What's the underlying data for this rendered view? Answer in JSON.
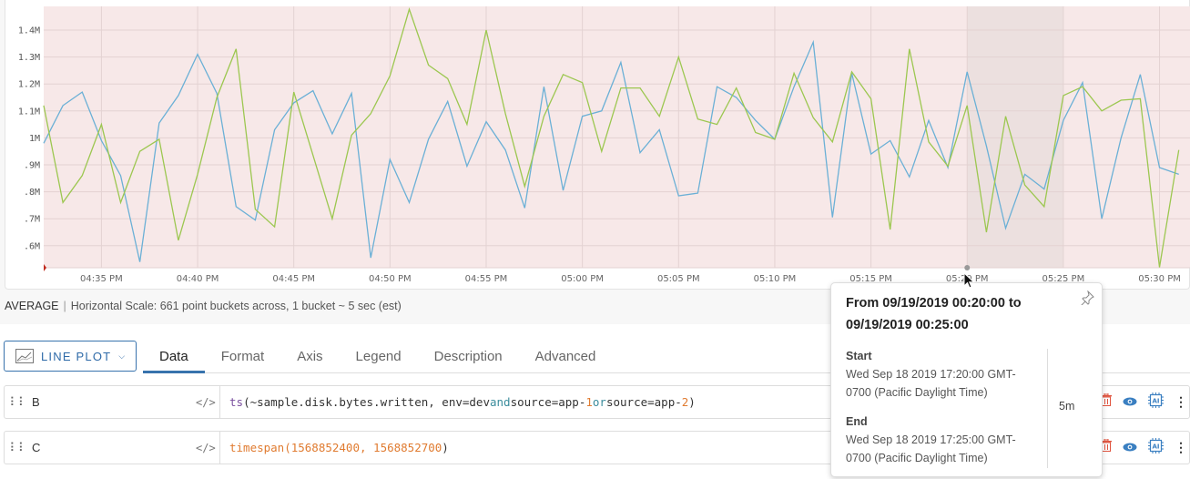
{
  "chart_data": {
    "type": "line",
    "title": "",
    "xlabel": "",
    "ylabel": "",
    "ylim": [
      0.52,
      1.48
    ],
    "y_unit": "M",
    "yticks": [
      0.6,
      0.7,
      0.8,
      0.9,
      1.0,
      1.1,
      1.2,
      1.3,
      1.4
    ],
    "ytick_labels": [
      ".6M",
      ".7M",
      ".8M",
      ".9M",
      "1M",
      "1.1M",
      "1.2M",
      "1.3M",
      "1.4M"
    ],
    "x_start": "04:32 PM",
    "x_step_minutes": 1,
    "xtick_labels": [
      "04:35 PM",
      "04:40 PM",
      "04:45 PM",
      "04:50 PM",
      "04:55 PM",
      "05:00 PM",
      "05:05 PM",
      "05:10 PM",
      "05:15 PM",
      "05:20 PM",
      "05:25 PM",
      "05:30 PM"
    ],
    "xtick_minute_offsets": [
      3,
      8,
      13,
      18,
      23,
      28,
      33,
      38,
      43,
      48,
      53,
      58
    ],
    "grid": true,
    "background_color": "#f7e8e8",
    "highlight_range": {
      "from": "05:20 PM",
      "to": "05:25 PM",
      "color": "#ece0df"
    },
    "series": [
      {
        "name": "app-1",
        "color": "#6bb0d6",
        "values": [
          0.98,
          1.12,
          1.17,
          0.99,
          0.86,
          0.54,
          1.055,
          1.157,
          1.31,
          1.165,
          0.745,
          0.695,
          1.03,
          1.13,
          1.175,
          1.015,
          1.165,
          0.555,
          0.92,
          0.76,
          0.995,
          1.135,
          0.895,
          1.06,
          0.955,
          0.74,
          1.19,
          0.805,
          1.08,
          1.1,
          1.28,
          0.945,
          1.03,
          0.785,
          0.795,
          1.19,
          1.15,
          1.065,
          0.995,
          1.19,
          1.355,
          0.705,
          1.24,
          0.94,
          0.99,
          0.855,
          1.065,
          0.89,
          1.245,
          0.97,
          0.665,
          0.865,
          0.81,
          1.065,
          1.205,
          0.7,
          1.0,
          1.235,
          0.89,
          0.865
        ]
      },
      {
        "name": "app-2",
        "color": "#9cc750",
        "values": [
          1.12,
          0.76,
          0.86,
          1.05,
          0.76,
          0.95,
          0.995,
          0.62,
          0.865,
          1.15,
          1.33,
          0.735,
          0.67,
          1.17,
          0.935,
          0.7,
          1.01,
          1.09,
          1.23,
          1.477,
          1.27,
          1.22,
          1.05,
          1.4,
          1.09,
          0.82,
          1.08,
          1.235,
          1.205,
          0.95,
          1.185,
          1.185,
          1.08,
          1.3,
          1.07,
          1.05,
          1.185,
          1.02,
          0.995,
          1.24,
          1.075,
          0.985,
          1.245,
          1.145,
          0.66,
          1.33,
          0.985,
          0.895,
          1.12,
          0.65,
          1.08,
          0.825,
          0.745,
          1.157,
          1.19,
          1.1,
          1.14,
          1.145,
          0.52,
          0.955
        ]
      }
    ]
  },
  "summary": {
    "aggregation": "AVERAGE",
    "separator": "|",
    "scale_text": "Horizontal Scale: 661 point buckets across, 1 bucket ~ 5 sec (est)"
  },
  "chart_type": {
    "label": "LINE PLOT",
    "icon": "line-chart-icon"
  },
  "tabs": [
    {
      "label": "Data",
      "active": true
    },
    {
      "label": "Format",
      "active": false
    },
    {
      "label": "Axis",
      "active": false
    },
    {
      "label": "Legend",
      "active": false
    },
    {
      "label": "Description",
      "active": false
    },
    {
      "label": "Advanced",
      "active": false
    }
  ],
  "queries": [
    {
      "name": "B",
      "toggle": "</>",
      "tokens": [
        {
          "t": "ts",
          "c": "k-fn"
        },
        {
          "t": "(~sample.disk.bytes.written, env=dev ",
          "c": ""
        },
        {
          "t": "and",
          "c": "k-op"
        },
        {
          "t": " source=app-",
          "c": ""
        },
        {
          "t": "1",
          "c": "k-num"
        },
        {
          "t": " ",
          "c": ""
        },
        {
          "t": "or",
          "c": "k-op"
        },
        {
          "t": " source=app-",
          "c": ""
        },
        {
          "t": "2",
          "c": "k-num"
        },
        {
          "t": ")",
          "c": ""
        }
      ]
    },
    {
      "name": "C",
      "toggle": "</>",
      "tokens": [
        {
          "t": "timespan(1568852400, 1568852700",
          "c": "k-ts"
        },
        {
          "t": ")",
          "c": ""
        }
      ]
    }
  ],
  "tooltip": {
    "title": "From 09/19/2019 00:20:00 to 09/19/2019 00:25:00",
    "start_label": "Start",
    "start_value": "Wed Sep 18 2019 17:20:00 GMT-0700 (Pacific Daylight Time)",
    "end_label": "End",
    "end_value": "Wed Sep 18 2019 17:25:00 GMT-0700 (Pacific Daylight Time)",
    "duration": "5m"
  }
}
